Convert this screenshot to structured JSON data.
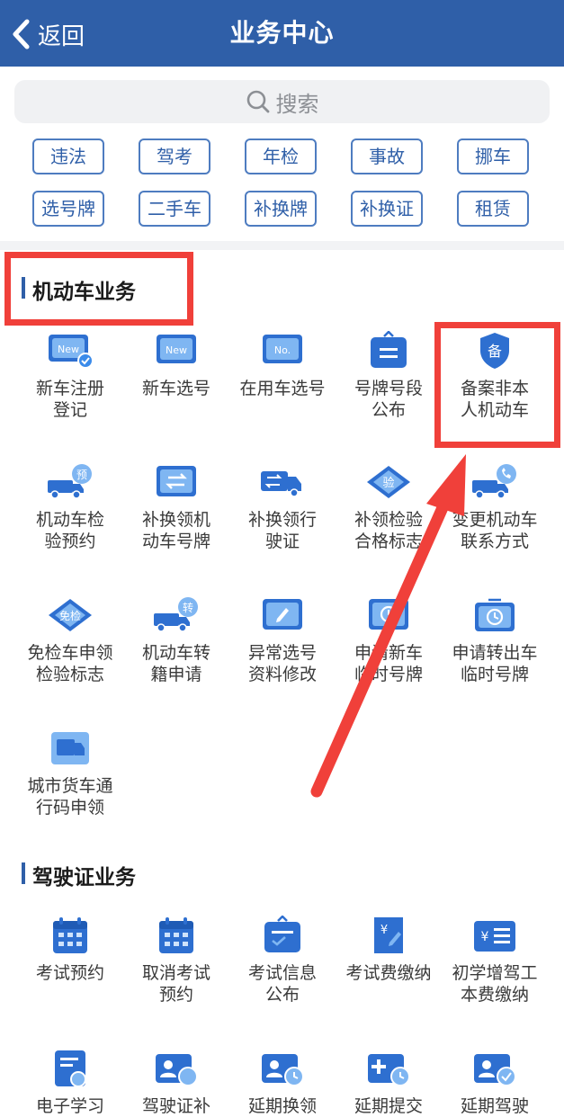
{
  "header": {
    "back_label": "返回",
    "title": "业务中心"
  },
  "search": {
    "placeholder": "搜索"
  },
  "quick_tags": [
    "违法",
    "驾考",
    "年检",
    "事故",
    "挪车",
    "选号牌",
    "二手车",
    "补换牌",
    "补换证",
    "租赁"
  ],
  "sections": [
    {
      "title": "机动车业务",
      "items": [
        {
          "label": "新车注册\n登记",
          "icon": "new-badge-check-icon"
        },
        {
          "label": "新车选号",
          "icon": "new-badge-icon"
        },
        {
          "label": "在用车选号",
          "icon": "number-plate-icon"
        },
        {
          "label": "号牌号段\n公布",
          "icon": "plate-board-icon"
        },
        {
          "label": "备案非本\n人机动车",
          "icon": "record-shield-icon"
        },
        {
          "label": "机动车检\n验预约",
          "icon": "truck-check-appointment-icon"
        },
        {
          "label": "补换领机\n动车号牌",
          "icon": "swap-plate-icon"
        },
        {
          "label": "补换领行\n驶证",
          "icon": "swap-license-icon"
        },
        {
          "label": "补领检验\n合格标志",
          "icon": "inspection-badge-icon"
        },
        {
          "label": "变更机动车\n联系方式",
          "icon": "truck-phone-icon"
        },
        {
          "label": "免检车申领\n检验标志",
          "icon": "exempt-badge-icon"
        },
        {
          "label": "机动车转\n籍申请",
          "icon": "truck-transfer-icon"
        },
        {
          "label": "异常选号\n资料修改",
          "icon": "edit-plate-icon"
        },
        {
          "label": "申请新车\n临时号牌",
          "icon": "temp-plate-icon"
        },
        {
          "label": "申请转出车\n临时号牌",
          "icon": "temp-plate-transfer-icon"
        },
        {
          "label": "城市货车通\n行码申领",
          "icon": "cargo-truck-icon"
        }
      ]
    },
    {
      "title": "驾驶证业务",
      "items": [
        {
          "label": "考试预约",
          "icon": "calendar-icon"
        },
        {
          "label": "取消考试\n预约",
          "icon": "calendar-cancel-icon"
        },
        {
          "label": "考试信息\n公布",
          "icon": "exam-info-icon"
        },
        {
          "label": "考试费缴纳",
          "icon": "exam-fee-icon"
        },
        {
          "label": "初学增驾工\n本费缴纳",
          "icon": "fee-list-icon"
        },
        {
          "label": "电子学习",
          "icon": "e-learning-icon"
        },
        {
          "label": "驾驶证补",
          "icon": "license-reissue-icon"
        },
        {
          "label": "延期换领",
          "icon": "extend-renew-icon"
        },
        {
          "label": "延期提交",
          "icon": "extend-submit-icon"
        },
        {
          "label": "延期驾驶",
          "icon": "extend-drive-icon"
        }
      ]
    }
  ],
  "colors": {
    "header": "#2f5fa8",
    "accent": "#4e7cc0",
    "icon_primary": "#2e6fd0",
    "icon_light": "#7fb6f2",
    "annotation": "#f0403a"
  }
}
